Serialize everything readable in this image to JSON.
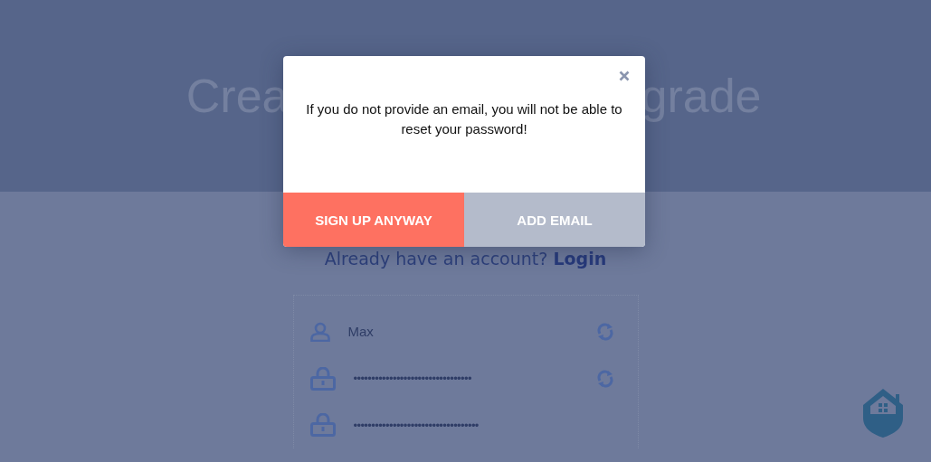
{
  "header": {
    "title_left": "Crea",
    "title_right": "grade"
  },
  "login_prompt": {
    "text": "Already have an account?",
    "link": "Login"
  },
  "form": {
    "fields": [
      {
        "kind": "text",
        "value": "Max",
        "refresh": true
      },
      {
        "kind": "password",
        "value": "•••••••••••••••••••••••••••••••••",
        "refresh": true
      },
      {
        "kind": "password",
        "value": "•••••••••••••••••••••••••••••••••••",
        "refresh": false
      }
    ]
  },
  "modal": {
    "message": "If you do not provide an email, you will not be able to reset your password!",
    "buttons": [
      {
        "kind": "primary",
        "label": "SIGN UP ANYWAY"
      },
      {
        "kind": "secondary",
        "label": "ADD EMAIL"
      }
    ]
  }
}
